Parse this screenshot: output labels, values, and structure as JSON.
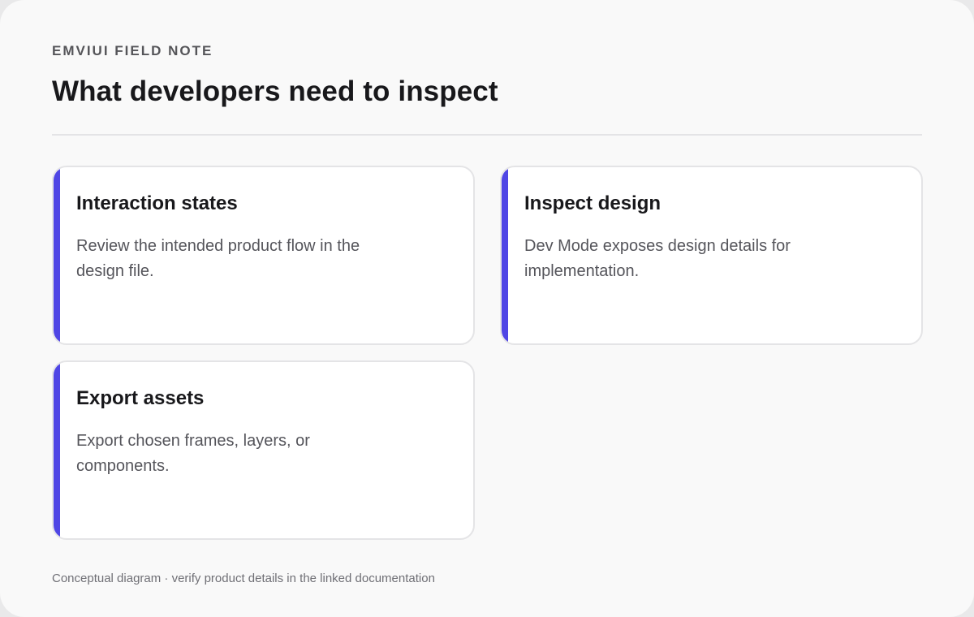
{
  "header": {
    "eyebrow": "EMVIUI FIELD NOTE",
    "title": "What developers need to inspect"
  },
  "cards": [
    {
      "title": "Interaction states",
      "body": "Review the intended product flow in the design file."
    },
    {
      "title": "Inspect design",
      "body": "Dev Mode exposes design details for implementation."
    },
    {
      "title": "Export assets",
      "body": "Export chosen frames, layers, or components."
    }
  ],
  "footer": {
    "note": "Conceptual diagram · verify product details in the linked documentation"
  },
  "colors": {
    "accent": "#4f46e5",
    "background": "#f9f9f9",
    "card": "#ffffff"
  }
}
